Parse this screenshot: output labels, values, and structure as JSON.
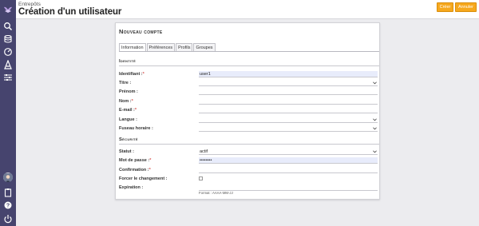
{
  "header": {
    "breadcrumb": "Entrepôts",
    "title": "Création d'un utilisateur",
    "create_label": "Créer",
    "cancel_label": "Annuler"
  },
  "sidebar": {
    "icons": [
      "logo-icon",
      "search-icon",
      "database-icon",
      "dashboard-icon",
      "users-icon",
      "settings-icon",
      "avatar",
      "clipboard-icon",
      "help-icon",
      "power-icon"
    ]
  },
  "panel": {
    "title": "Nouveau compte",
    "tabs": [
      "Information",
      "Préférences",
      "Profils",
      "Groupes"
    ],
    "active_tab": "Information"
  },
  "sections": {
    "identity": "Identité",
    "security": "Sécurité"
  },
  "fields": {
    "identifiant": {
      "label": "Identifiant :",
      "required": "*",
      "value": "user1"
    },
    "titre": {
      "label": "Titre :",
      "value": ""
    },
    "prenom": {
      "label": "Prénom :",
      "value": ""
    },
    "nom": {
      "label": "Nom :",
      "required": "*",
      "value": ""
    },
    "email": {
      "label": "E-mail :",
      "required": "*",
      "value": ""
    },
    "langue": {
      "label": "Langue :",
      "value": ""
    },
    "fuseau": {
      "label": "Fuseau horaire :",
      "value": ""
    },
    "statut": {
      "label": "Statut :",
      "value": "actif"
    },
    "motdepasse": {
      "label": "Mot de passe :",
      "required": "*",
      "value": "••••••••"
    },
    "confirmation": {
      "label": "Confirmation :",
      "required": "*",
      "value": ""
    },
    "forcer": {
      "label": "Forcer le changement :",
      "checked": false
    },
    "expiration": {
      "label": "Expiration :",
      "value": "",
      "hint": "Format : AAAA-MM-JJ"
    }
  },
  "colors": {
    "sidebar": "#46446e",
    "accent": "#f6a81d",
    "filled_field": "#e8ecfb"
  }
}
